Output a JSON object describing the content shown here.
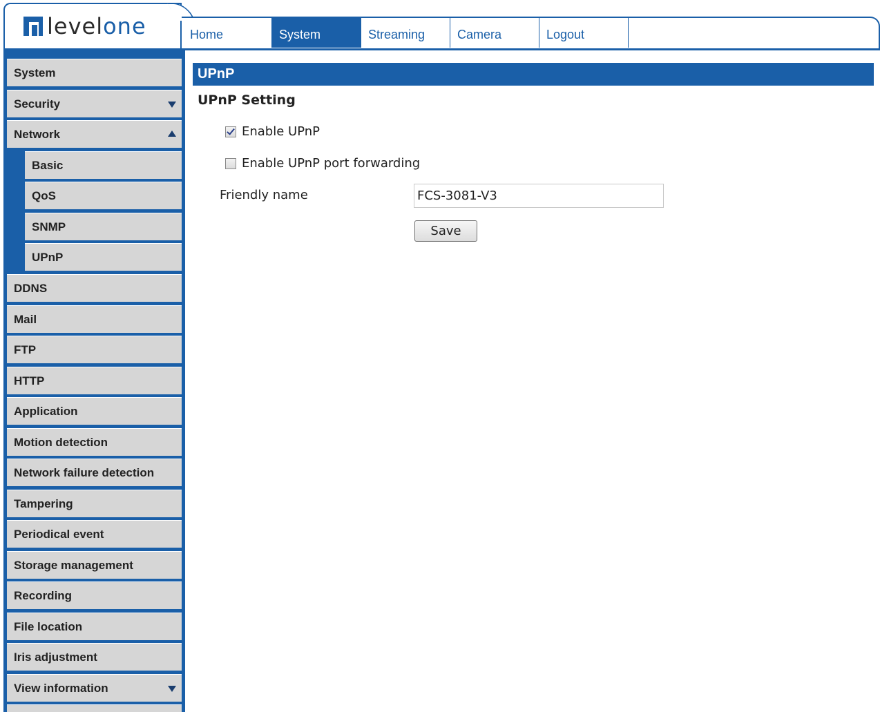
{
  "brand": {
    "name_part1": "level",
    "name_part2": "one"
  },
  "top_nav": {
    "tabs": [
      {
        "label": "Home",
        "active": false
      },
      {
        "label": "System",
        "active": true
      },
      {
        "label": "Streaming",
        "active": false
      },
      {
        "label": "Camera",
        "active": false
      },
      {
        "label": "Logout",
        "active": false
      }
    ]
  },
  "sidebar": {
    "items": [
      {
        "label": "System"
      },
      {
        "label": "Security",
        "arrow": "down"
      },
      {
        "label": "Network",
        "arrow": "up"
      },
      {
        "label": "Basic",
        "sub": true
      },
      {
        "label": "QoS",
        "sub": true
      },
      {
        "label": "SNMP",
        "sub": true
      },
      {
        "label": "UPnP",
        "sub": true
      },
      {
        "label": "DDNS"
      },
      {
        "label": "Mail"
      },
      {
        "label": "FTP"
      },
      {
        "label": "HTTP"
      },
      {
        "label": "Application"
      },
      {
        "label": "Motion detection"
      },
      {
        "label": "Network failure detection"
      },
      {
        "label": "Tampering"
      },
      {
        "label": "Periodical event"
      },
      {
        "label": "Storage management"
      },
      {
        "label": "Recording"
      },
      {
        "label": "File location"
      },
      {
        "label": "Iris adjustment"
      },
      {
        "label": "View information",
        "arrow": "down"
      }
    ]
  },
  "main": {
    "title": "UPnP",
    "section_title": "UPnP Setting",
    "enable_upnp": {
      "label": "Enable UPnP",
      "checked": true
    },
    "enable_port_forwarding": {
      "label": "Enable UPnP port forwarding",
      "checked": false
    },
    "friendly_name": {
      "label": "Friendly name",
      "value": "FCS-3081-V3"
    },
    "save_label": "Save"
  },
  "colors": {
    "accent": "#1a5fa8",
    "sidebar_item_bg": "#d6d6d6"
  }
}
